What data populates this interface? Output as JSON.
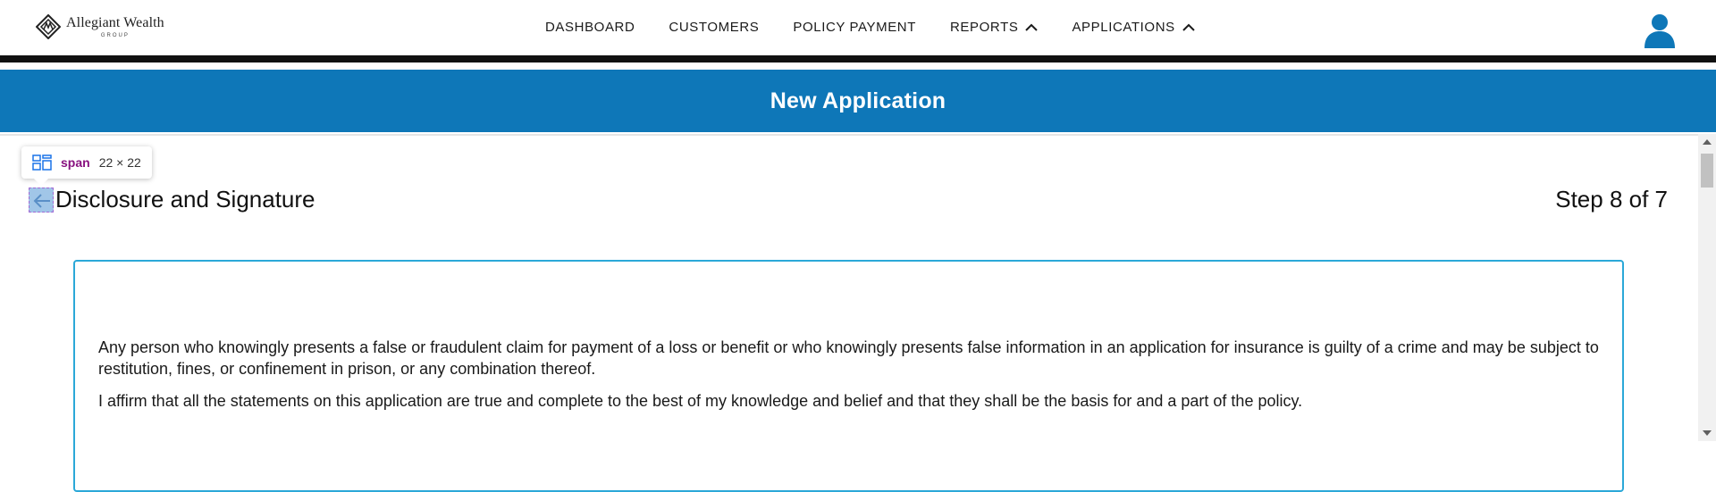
{
  "brand": {
    "name": "Allegiant Wealth",
    "subtitle": "GROUP"
  },
  "nav": {
    "items": [
      {
        "label": "DASHBOARD",
        "dropdown": false
      },
      {
        "label": "CUSTOMERS",
        "dropdown": false
      },
      {
        "label": "POLICY PAYMENT",
        "dropdown": false
      },
      {
        "label": "REPORTS",
        "dropdown": true
      },
      {
        "label": "APPLICATIONS",
        "dropdown": true
      }
    ],
    "user_icon": "user-account-icon"
  },
  "header": {
    "title": "New Application"
  },
  "inspector_tooltip": {
    "tag": "span",
    "dimensions": "22 × 22"
  },
  "section": {
    "title": "Disclosure and Signature",
    "step": "Step 8 of 7",
    "back_icon": "arrow-left-icon"
  },
  "disclosure": {
    "paragraphs": [
      "Any person who knowingly presents a false or fraudulent claim for payment of a loss or benefit or who knowingly presents false information in an application for insurance is guilty of a crime and may be subject to restitution, fines, or confinement in prison, or any combination thereof.",
      "I affirm that all the statements on this application are true and complete to the best of my knowledge and belief and that they shall be the basis for and a part of the policy."
    ]
  },
  "colors": {
    "header_band": "#0e77b8",
    "card_border": "#2ba8d8",
    "nav_divider": "#111111"
  }
}
